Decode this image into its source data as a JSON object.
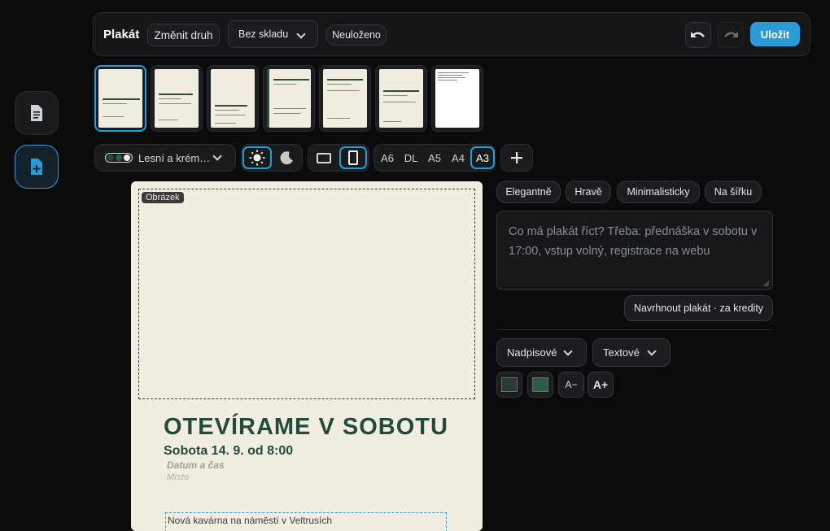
{
  "rail": {
    "items": [
      {
        "name": "documents"
      },
      {
        "name": "new-document"
      }
    ]
  },
  "header": {
    "title": "Plakát",
    "change_type_label": "Změnit druh",
    "warehouse_select": "Bez skladu",
    "status_badge": "Neuloženo",
    "save_label": "Uložit"
  },
  "toolbar": {
    "palette_label": "Lesní a krém…",
    "formats": [
      "A6",
      "DL",
      "A5",
      "A4",
      "A3"
    ],
    "selected_format": "A3"
  },
  "poster": {
    "image_label": "Obrázek",
    "headline": "OTEVÍRAME V SOBOTU",
    "subheadline": "Sobota 14. 9. od 8:00",
    "date_placeholder": "Datum a čas",
    "place_placeholder": "Místo",
    "body_text": "Nová kavárna na náměstí v Veltrusích"
  },
  "styles": [
    "Elegantně",
    "Hravě",
    "Minimalisticky",
    "Na šířku"
  ],
  "prompt": {
    "placeholder": "Co má plakát říct? Třeba: přednáška v sobotu v 17:00, vstup volný, registrace na webu",
    "generate_label": "Navrhnout plakát · za kredity"
  },
  "typography": {
    "heading_font": "Nadpisové",
    "text_font": "Textové",
    "decrease_label": "A−",
    "increase_label": "A+"
  },
  "colors": {
    "accent": "#2a9bd6",
    "poster_bg": "#f2ede1",
    "poster_green": "#234a3a",
    "swatch_dark": "#2b3a31",
    "swatch_green": "#2c5c47"
  }
}
